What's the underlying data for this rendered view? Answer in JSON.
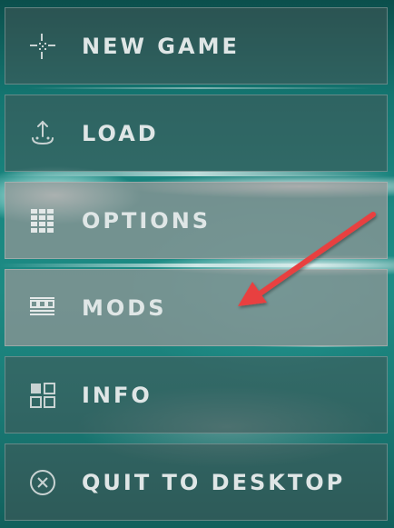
{
  "menu": {
    "items": [
      {
        "id": "new-game",
        "label": "NEW GAME",
        "icon": "crosshair-icon"
      },
      {
        "id": "load",
        "label": "LOAD",
        "icon": "upload-icon"
      },
      {
        "id": "options",
        "label": "OPTIONS",
        "icon": "grid-icon"
      },
      {
        "id": "mods",
        "label": "MODS",
        "icon": "mods-icon"
      },
      {
        "id": "info",
        "label": "INFO",
        "icon": "tiles-icon"
      },
      {
        "id": "quit",
        "label": "QUIT TO DESKTOP",
        "icon": "close-circle-icon"
      }
    ]
  },
  "annotation": {
    "type": "arrow",
    "color": "#e8403f",
    "points_to": "mods"
  },
  "colors": {
    "background": "#1a8882",
    "label": "#dfe6e6",
    "icon": "#c9d3d3"
  }
}
